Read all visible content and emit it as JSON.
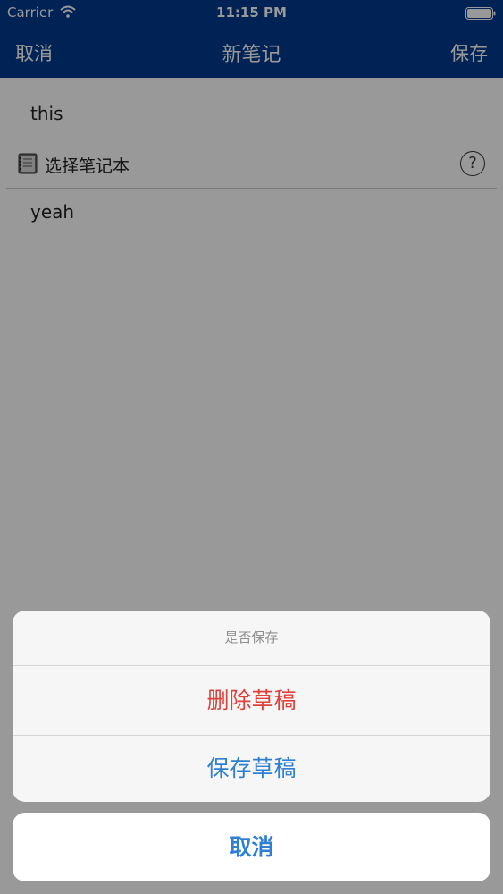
{
  "status_bar": {
    "carrier": "Carrier",
    "time": "11:15 PM"
  },
  "nav": {
    "left_label": "取消",
    "title": "新笔记",
    "right_label": "保存",
    "background": "#003a8c"
  },
  "note": {
    "title": "this",
    "notebook_label": "选择笔记本",
    "help_glyph": "?",
    "body": "yeah"
  },
  "action_sheet": {
    "title": "是否保存",
    "delete_label": "删除草稿",
    "save_label": "保存草稿",
    "cancel_label": "取消",
    "destructive_color": "#e0403a",
    "action_color": "#2f7fd4"
  }
}
